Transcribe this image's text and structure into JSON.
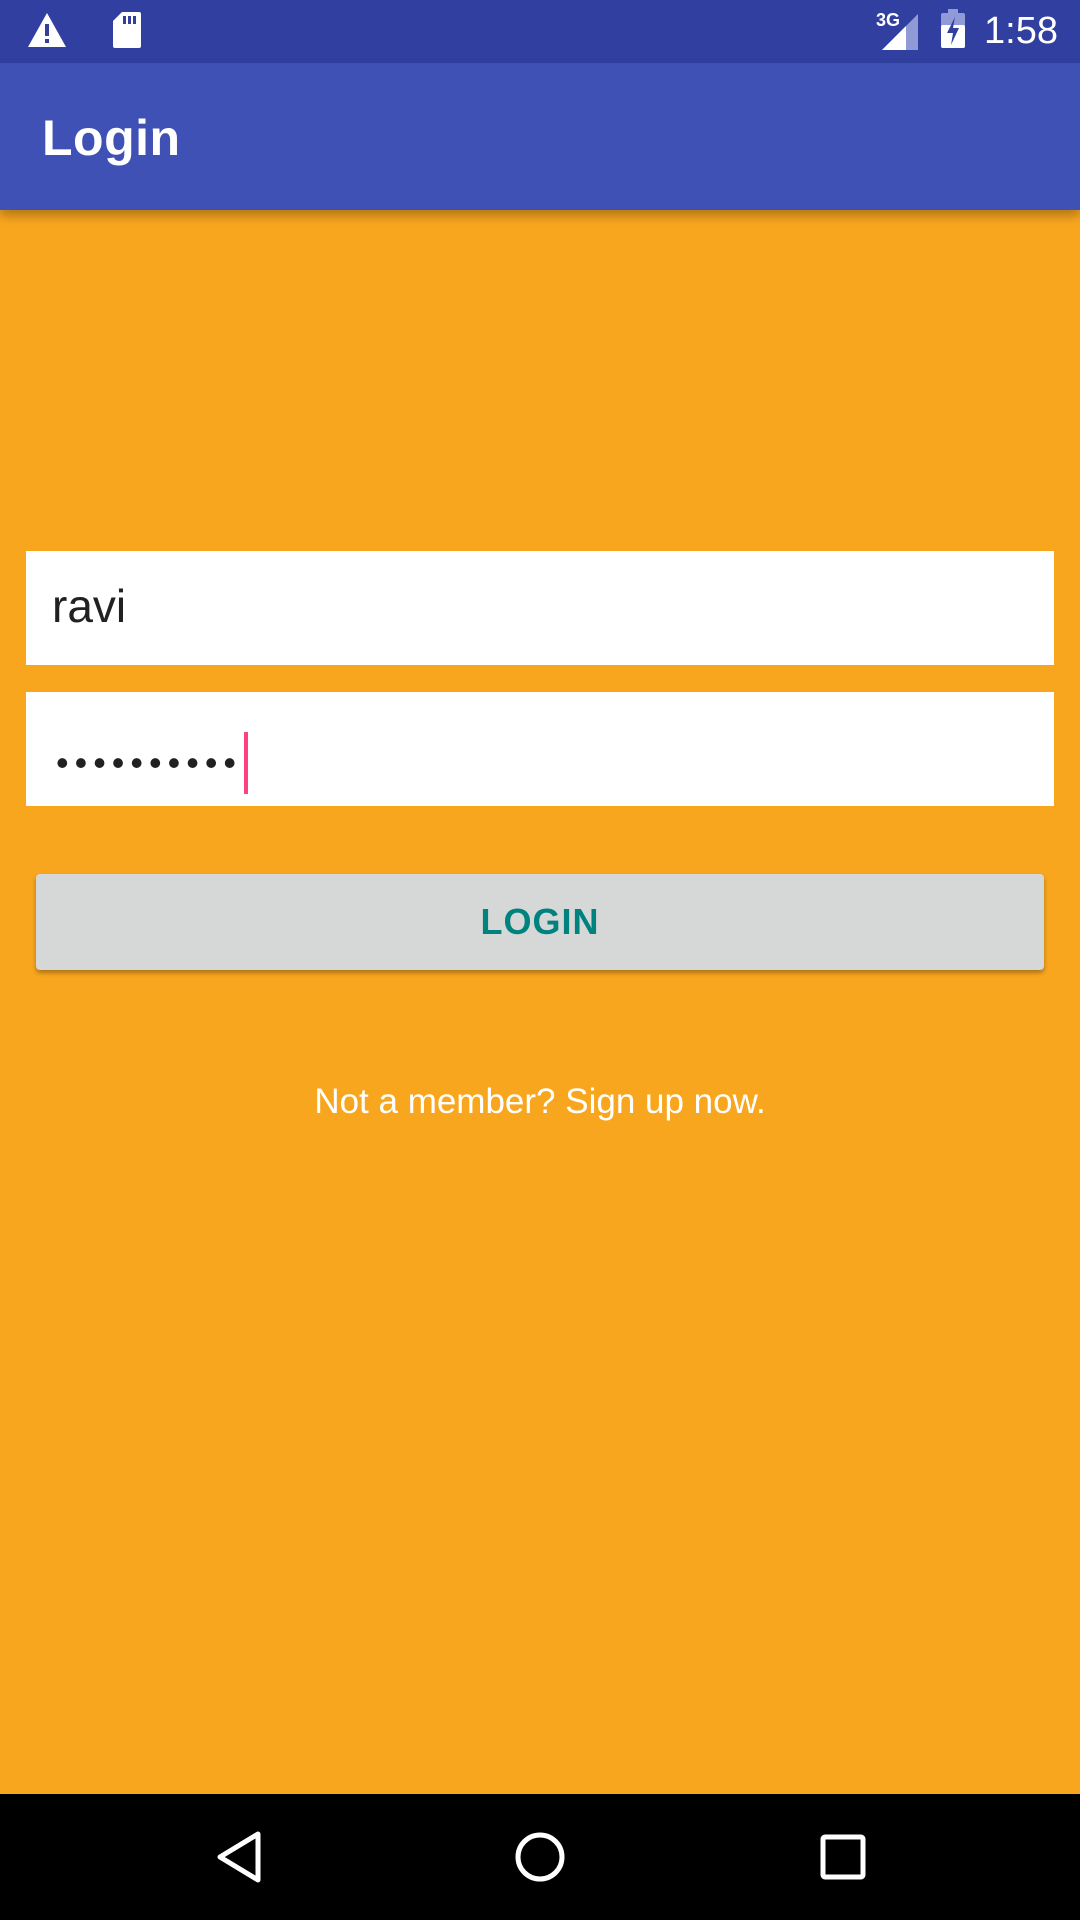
{
  "status_bar": {
    "time": "1:58",
    "network_type": "3G",
    "icons": [
      "warning-icon",
      "sd-card-icon",
      "signal-icon",
      "battery-charging-icon"
    ]
  },
  "app_bar": {
    "title": "Login"
  },
  "form": {
    "username_value": "ravi",
    "password_mask": "••••••••••",
    "login_label": "LOGIN",
    "signup_text": "Not a member? Sign up now."
  },
  "colors": {
    "background": "#F9A61F",
    "status_bar": "#3140A0",
    "app_bar": "#3F51B5",
    "button": "#D6D7D7",
    "button_text": "#00827F",
    "cursor": "#FF4081"
  },
  "nav_bar": {
    "icons": [
      "back-icon",
      "home-icon",
      "recents-icon"
    ]
  }
}
